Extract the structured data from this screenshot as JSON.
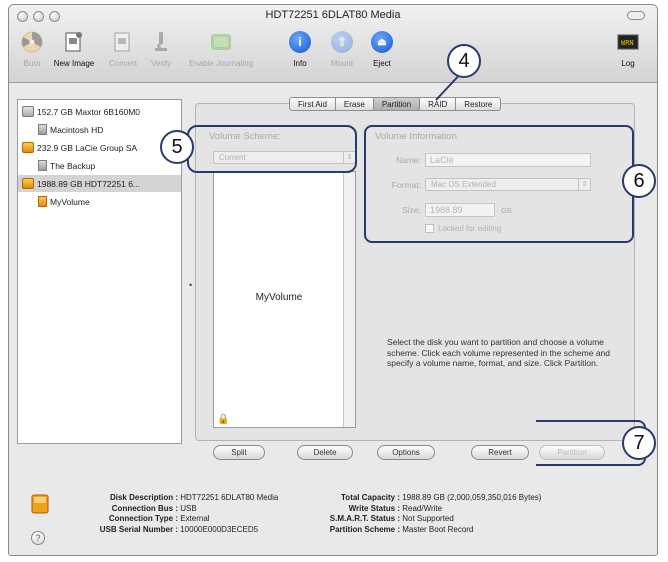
{
  "window": {
    "title": "HDT72251 6DLAT80 Media"
  },
  "toolbar": {
    "burn": "Burn",
    "new_image": "New Image",
    "convert": "Convert",
    "verify": "Verify",
    "enable_journaling": "Enable Journaling",
    "info": "Info",
    "mount": "Mount",
    "eject": "Eject",
    "log": "Log"
  },
  "sidebar": {
    "items": [
      {
        "label": "152.7 GB Maxtor 6B160M0"
      },
      {
        "label": "Macintosh HD"
      },
      {
        "label": "232.9 GB LaCie Group SA"
      },
      {
        "label": "The Backup"
      },
      {
        "label": "1988.89 GB HDT72251 6..."
      },
      {
        "label": "MyVolume"
      }
    ]
  },
  "tabs": [
    "First Aid",
    "Erase",
    "Partition",
    "RAID",
    "Restore"
  ],
  "partition": {
    "volume_scheme_label": "Volume Scheme:",
    "volume_scheme_value": "Current",
    "volume_info_label": "Volume Information",
    "name_label": "Name:",
    "name_value": "LaCie",
    "format_label": "Format:",
    "format_value": "Mac OS Extended",
    "size_label": "Size:",
    "size_value": "1988.89",
    "size_unit": "GB",
    "locked_label": "Locked for editing",
    "scheme_volume_name": "MyVolume",
    "help_text": "Select the disk you want to partition and choose a volume scheme. Click each volume represented in the scheme and specify a volume name, format, and size. Click Partition."
  },
  "buttons": {
    "split": "Split",
    "delete": "Delete",
    "options": "Options",
    "revert": "Revert",
    "partition": "Partition"
  },
  "info": {
    "disk_description_k": "Disk Description :",
    "disk_description_v": "HDT72251 6DLAT80 Media",
    "connection_bus_k": "Connection Bus :",
    "connection_bus_v": "USB",
    "connection_type_k": "Connection Type :",
    "connection_type_v": "External",
    "usb_serial_k": "USB Serial Number :",
    "usb_serial_v": "10000E000D3ECED5",
    "total_capacity_k": "Total Capacity :",
    "total_capacity_v": "1988.89 GB (2,000,059,350,016 Bytes)",
    "write_status_k": "Write Status :",
    "write_status_v": "Read/Write",
    "smart_k": "S.M.A.R.T. Status :",
    "smart_v": "Not Supported",
    "partition_scheme_k": "Partition Scheme :",
    "partition_scheme_v": "Master Boot Record"
  },
  "callouts": {
    "c4": "4",
    "c5": "5",
    "c6": "6",
    "c7": "7"
  },
  "help_button": "?"
}
